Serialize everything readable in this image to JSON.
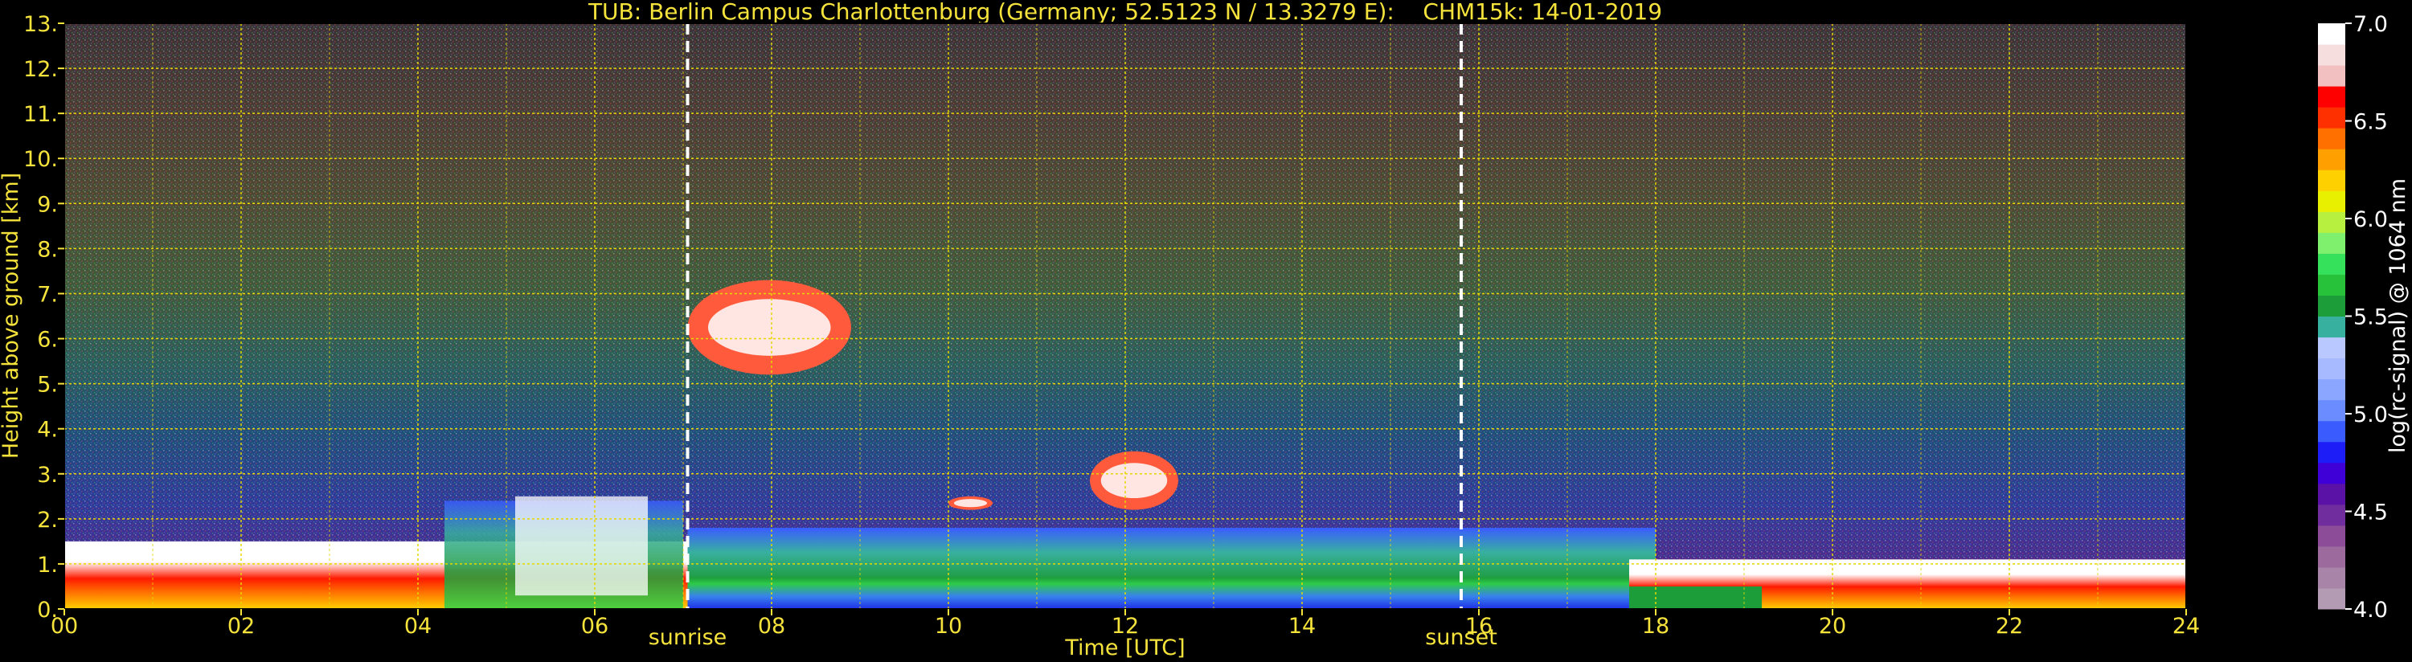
{
  "chart_data": {
    "type": "heatmap",
    "title": "TUB: Berlin Campus Charlottenburg (Germany; 52.5123 N / 13.3279 E):    CHM15k: 14-01-2019",
    "xlabel": "Time [UTC]",
    "ylabel": "Height above ground [km]",
    "xlim": [
      0,
      24
    ],
    "ylim": [
      0,
      13
    ],
    "x_ticks": [
      "00",
      "02",
      "04",
      "06",
      "08",
      "10",
      "12",
      "14",
      "16",
      "18",
      "20",
      "22",
      "24"
    ],
    "x_tick_values": [
      0,
      2,
      4,
      6,
      8,
      10,
      12,
      14,
      16,
      18,
      20,
      22,
      24
    ],
    "y_ticks": [
      "0.",
      "1.",
      "2.",
      "3.",
      "4.",
      "5.",
      "6.",
      "7.",
      "8.",
      "9.",
      "10.",
      "11.",
      "12.",
      "13."
    ],
    "y_tick_values": [
      0,
      1,
      2,
      3,
      4,
      5,
      6,
      7,
      8,
      9,
      10,
      11,
      12,
      13
    ],
    "grid": true,
    "markers": [
      {
        "label": "sunrise",
        "time": 7.05
      },
      {
        "label": "sunset",
        "time": 15.8
      }
    ],
    "colorbar": {
      "label": "log(rc-signal) @ 1064 nm",
      "range": [
        4.0,
        7.0
      ],
      "ticks": [
        "4.0",
        "4.5",
        "5.0",
        "5.5",
        "6.0",
        "6.5",
        "7.0"
      ],
      "tick_values": [
        4.0,
        4.5,
        5.0,
        5.5,
        6.0,
        6.5,
        7.0
      ],
      "colors": [
        "#b49bb4",
        "#a884a8",
        "#9c6a9c",
        "#8c4c98",
        "#6f2d9e",
        "#5a12a6",
        "#3f00d8",
        "#1d1df8",
        "#3a5cff",
        "#6a8cff",
        "#8aa6ff",
        "#a7baff",
        "#b9c8ff",
        "#38b0a0",
        "#1d9c3a",
        "#27c13a",
        "#35e05a",
        "#7ff06e",
        "#b8f040",
        "#e8f000",
        "#ffd000",
        "#ffa000",
        "#ff7000",
        "#ff3000",
        "#ff0000",
        "#f2c0c0",
        "#f7dede",
        "#ffffff"
      ]
    },
    "features": [
      {
        "name": "boundary layer aerosol",
        "time": [
          0,
          24
        ],
        "height": [
          0,
          2.0
        ]
      },
      {
        "name": "cloud",
        "time": [
          7.05,
          8.9
        ],
        "height": [
          5.2,
          7.3
        ]
      },
      {
        "name": "cloud",
        "time": [
          11.6,
          12.6
        ],
        "height": [
          2.2,
          3.5
        ]
      },
      {
        "name": "cloud",
        "time": [
          10.0,
          10.5
        ],
        "height": [
          2.2,
          2.5
        ]
      }
    ]
  }
}
